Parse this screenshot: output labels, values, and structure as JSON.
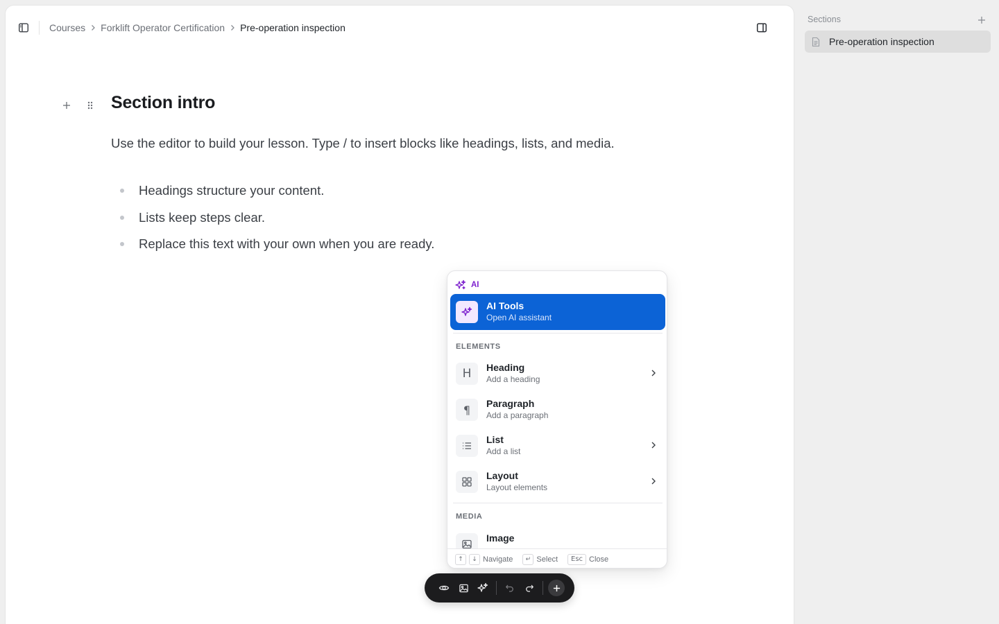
{
  "breadcrumb": {
    "items": [
      "Courses",
      "Forklift Operator Certification",
      "Pre-operation inspection"
    ]
  },
  "editor": {
    "heading": "Section intro",
    "paragraph": "Use the editor to build your lesson. Type / to insert blocks like headings, lists, and media.",
    "bullets": [
      "Headings structure your content.",
      "Lists keep steps clear.",
      "Replace this text with your own when you are ready."
    ]
  },
  "menu": {
    "ai_header": "AI",
    "ai_item": {
      "title": "AI Tools",
      "subtitle": "Open AI assistant",
      "icon": "sparkles-icon"
    },
    "elements_label": "ELEMENTS",
    "elements": [
      {
        "title": "Heading",
        "subtitle": "Add a heading",
        "icon": "heading-icon",
        "has_submenu": true
      },
      {
        "title": "Paragraph",
        "subtitle": "Add a paragraph",
        "icon": "pilcrow-icon",
        "has_submenu": false
      },
      {
        "title": "List",
        "subtitle": "Add a list",
        "icon": "list-icon",
        "has_submenu": true
      },
      {
        "title": "Layout",
        "subtitle": "Layout elements",
        "icon": "grid-icon",
        "has_submenu": true
      }
    ],
    "media_label": "MEDIA",
    "media": [
      {
        "title": "Image",
        "icon": "image-icon"
      }
    ],
    "footer": {
      "up_key": "↑",
      "down_key": "↓",
      "navigate": "Navigate",
      "enter_key": "↵",
      "select": "Select",
      "esc_key": "Esc",
      "close": "Close"
    }
  },
  "sidebar": {
    "title": "Sections",
    "items": [
      {
        "label": "Pre-operation inspection",
        "selected": true
      }
    ]
  },
  "colors": {
    "accent": "#0c63d6",
    "ai_purple": "#7e22ce",
    "toolbar_bg": "#1c1c1e"
  }
}
